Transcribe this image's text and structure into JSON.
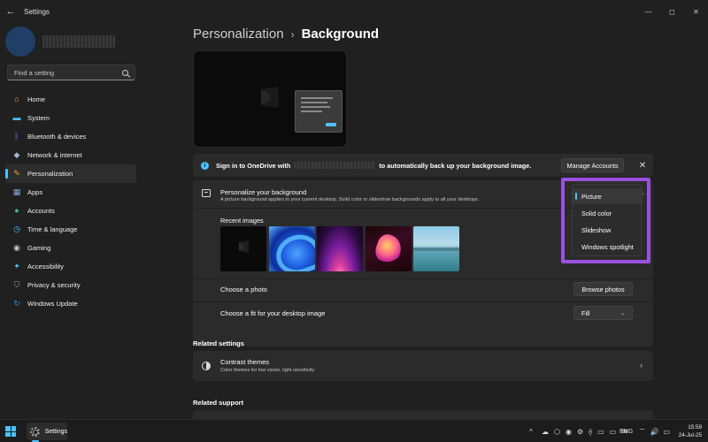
{
  "window": {
    "title": "Settings",
    "back_glyph": "←",
    "minimize_glyph": "—",
    "maximize_glyph": "◻",
    "close_glyph": "✕"
  },
  "sidebar": {
    "search_placeholder": "Find a setting",
    "items": [
      {
        "label": "Home",
        "icon": "home-icon",
        "color": "#f0a93a"
      },
      {
        "label": "System",
        "icon": "monitor-icon",
        "color": "#4cc2ff"
      },
      {
        "label": "Bluetooth & devices",
        "icon": "bluetooth-icon",
        "color": "#4c8dff"
      },
      {
        "label": "Network & internet",
        "icon": "network-icon",
        "color": "#9fb7d6"
      },
      {
        "label": "Personalization",
        "icon": "brush-icon",
        "color": "#f2a13b"
      },
      {
        "label": "Apps",
        "icon": "apps-icon",
        "color": "#7fa6d9"
      },
      {
        "label": "Accounts",
        "icon": "person-icon",
        "color": "#3fc07a"
      },
      {
        "label": "Time & language",
        "icon": "globe-clock-icon",
        "color": "#4cc2ff"
      },
      {
        "label": "Gaming",
        "icon": "gamepad-icon",
        "color": "#c8c8c8"
      },
      {
        "label": "Accessibility",
        "icon": "accessibility-icon",
        "color": "#4cc2ff"
      },
      {
        "label": "Privacy & security",
        "icon": "shield-icon",
        "color": "#9aa3ad"
      },
      {
        "label": "Windows Update",
        "icon": "update-icon",
        "color": "#2f8fe0"
      }
    ],
    "active_index": 4
  },
  "breadcrumb": {
    "parent": "Personalization",
    "separator": "›",
    "current": "Background"
  },
  "onedrive": {
    "text_before": "Sign in to OneDrive with",
    "text_after": "to automatically back up your background image.",
    "manage_label": "Manage Accounts",
    "info_glyph": "i",
    "close_glyph": "✕"
  },
  "personalize": {
    "title": "Personalize your background",
    "description": "A picture background applies to your current desktop. Solid color or slideshow backgrounds apply to all your desktops.",
    "recent_label": "Recent images",
    "choose_photo_label": "Choose a photo",
    "browse_label": "Browse photos",
    "fit_label": "Choose a fit for your desktop image",
    "fit_value": "Fill",
    "chevron_glyph": "⌄",
    "dropdown_options": [
      "Picture",
      "Solid color",
      "Slideshow",
      "Windows spotlight"
    ],
    "dropdown_selected_index": 0
  },
  "related_settings": {
    "heading": "Related settings",
    "contrast_title": "Contrast themes",
    "contrast_desc": "Color themes for low vision, light sensitivity",
    "chevron_glyph": "›"
  },
  "related_support": {
    "heading": "Related support"
  },
  "taskbar": {
    "app_label": "Settings",
    "tray_up_glyph": "^",
    "tray_lang": "ENG",
    "tray_glyphs": [
      "☁",
      "⬡",
      "◉",
      "⚙",
      "⟠",
      "▭",
      "▭",
      "✉"
    ],
    "tray_status_glyphs": [
      "⌔",
      "🔊",
      "▭"
    ],
    "time": "15:59",
    "date": "24-Jul-25"
  },
  "colors": {
    "accent": "#4cc2ff",
    "highlight": "#9b51e0",
    "background": "#202020",
    "card": "#2b2b2b"
  }
}
